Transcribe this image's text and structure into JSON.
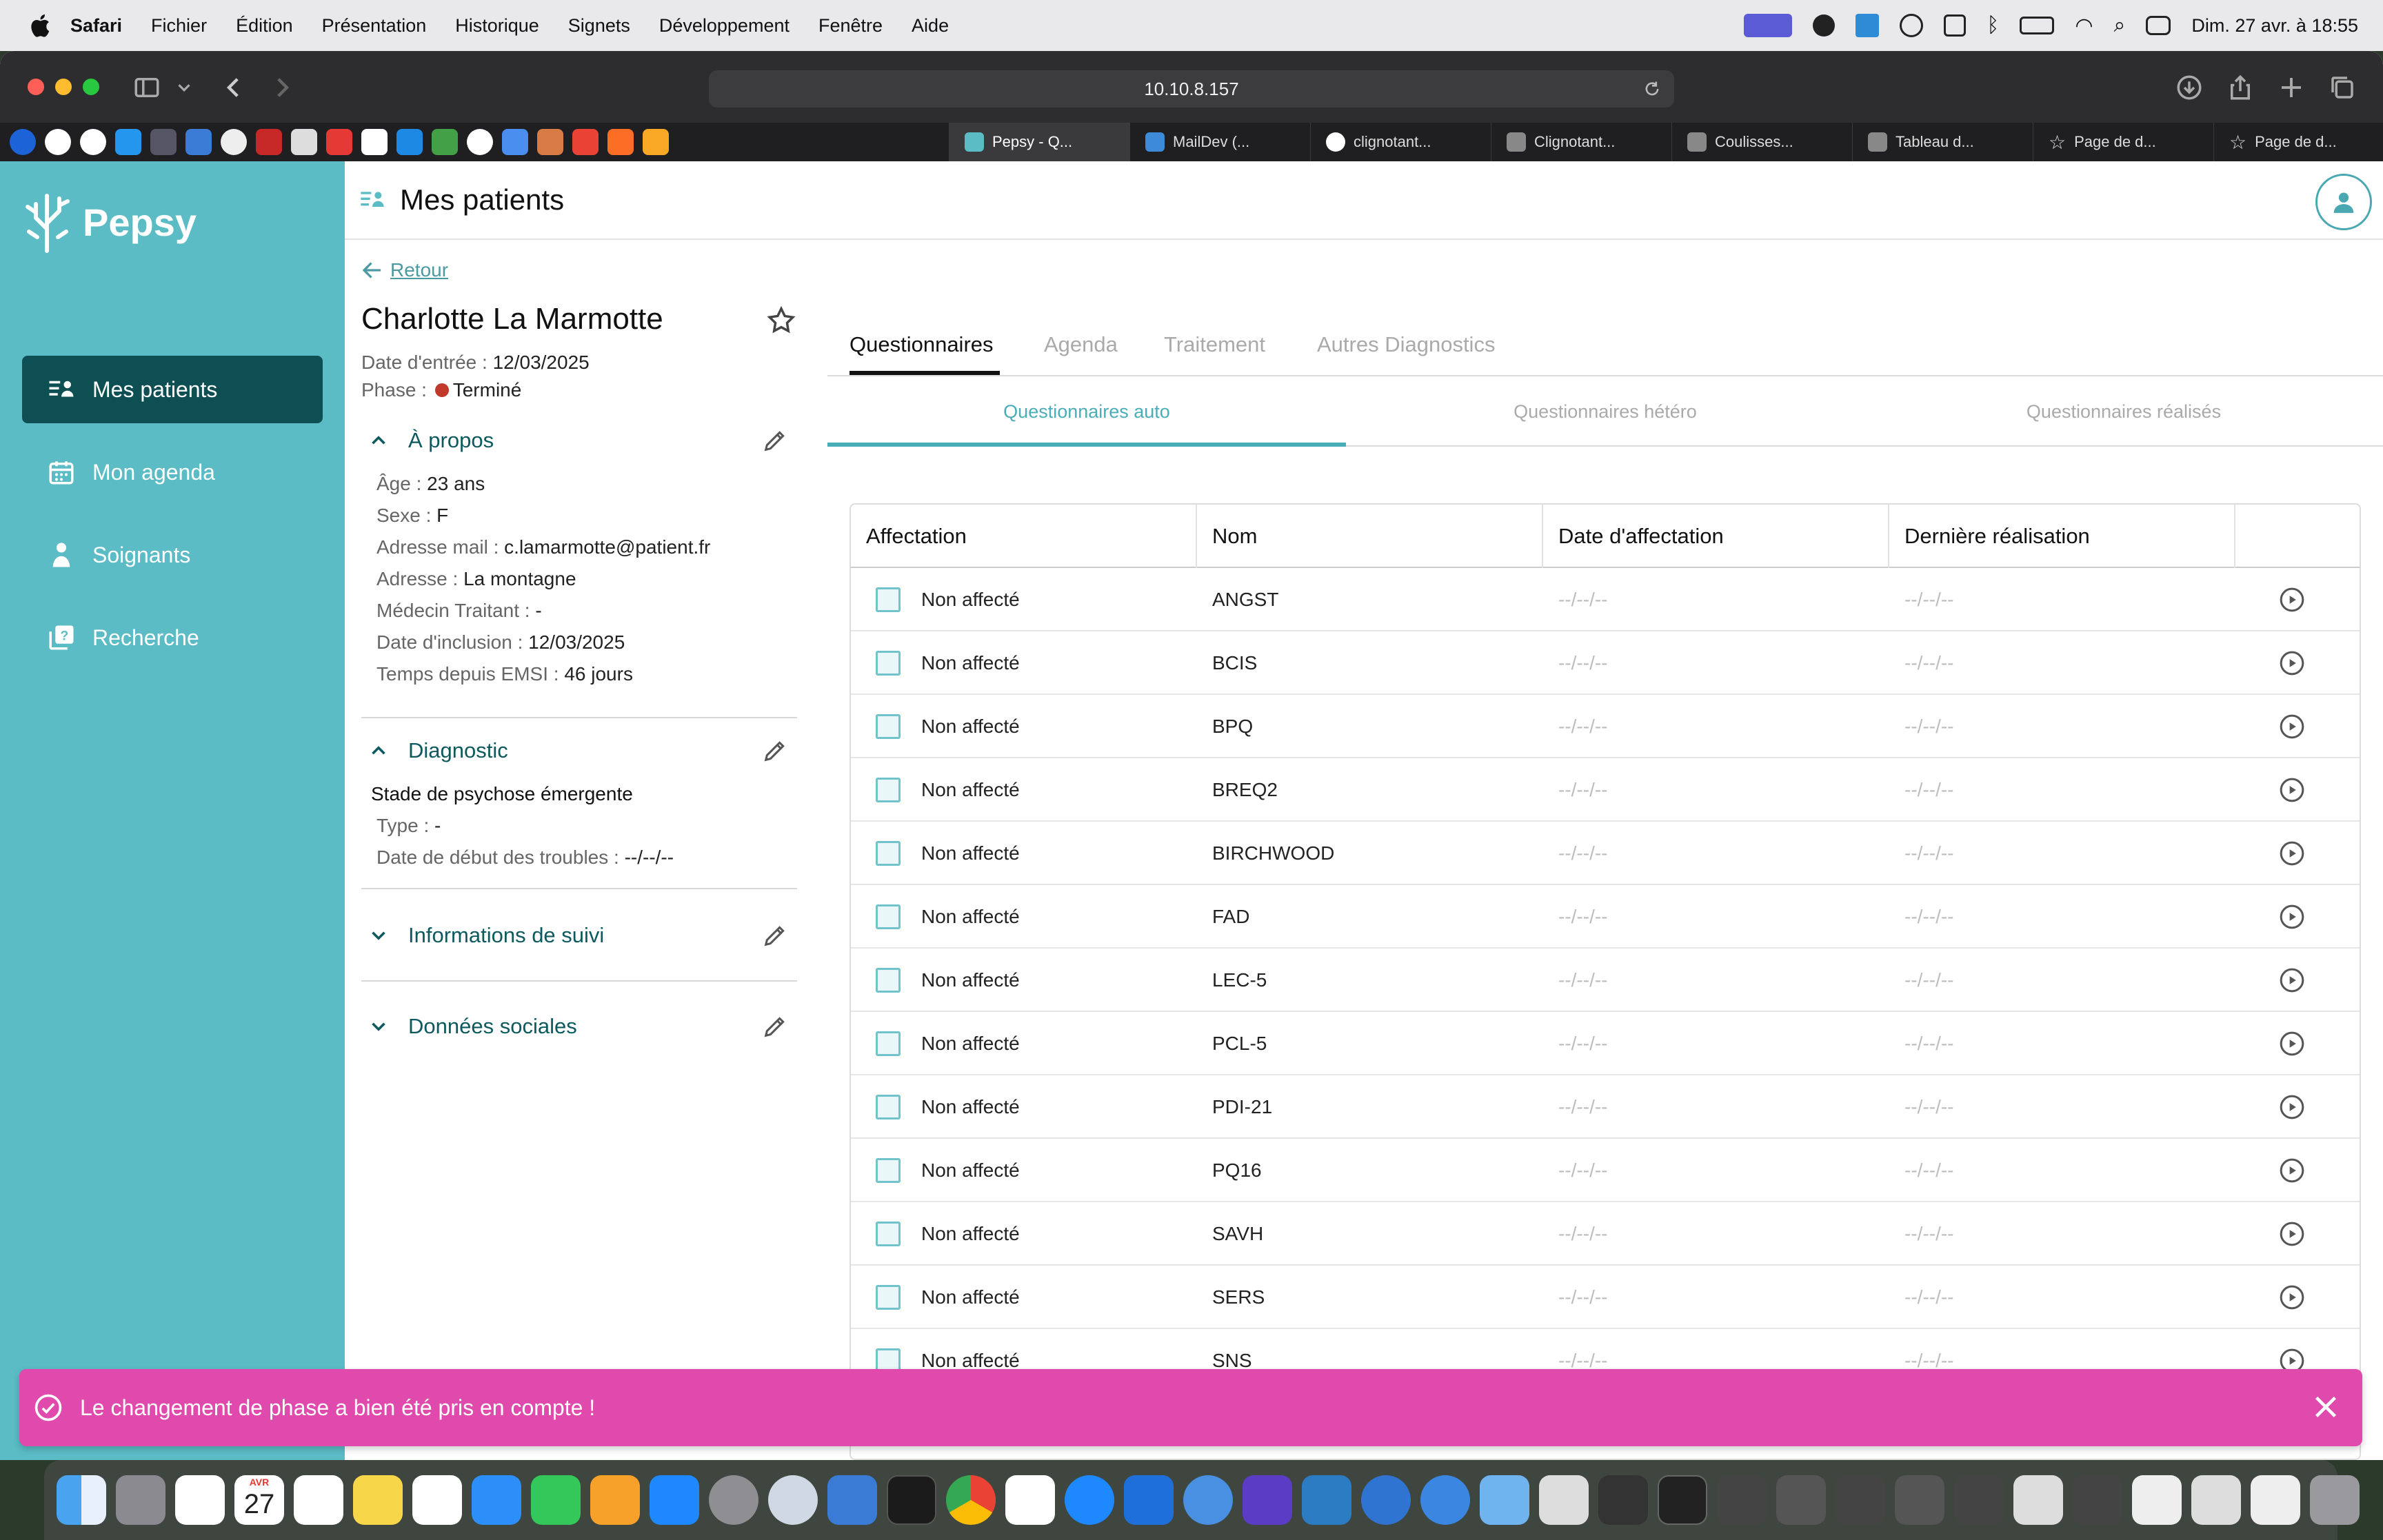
{
  "menubar": {
    "app": "Safari",
    "items": [
      "Fichier",
      "Édition",
      "Présentation",
      "Historique",
      "Signets",
      "Développement",
      "Fenêtre",
      "Aide"
    ],
    "datetime": "Dim. 27 avr. à 18:55"
  },
  "browser": {
    "url": "10.10.8.157",
    "tabs": [
      {
        "label": "Pepsy - Q...",
        "active": true
      },
      {
        "label": "MailDev (...",
        "active": false
      },
      {
        "label": "clignotant...",
        "active": false
      },
      {
        "label": "Clignotant...",
        "active": false
      },
      {
        "label": "Coulisses...",
        "active": false
      },
      {
        "label": "Tableau d...",
        "active": false
      },
      {
        "label": "Page de d...",
        "active": false
      },
      {
        "label": "Page de d...",
        "active": false
      }
    ]
  },
  "sidebar": {
    "logo": "Pepsy",
    "items": [
      {
        "label": "Mes patients",
        "active": true
      },
      {
        "label": "Mon agenda",
        "active": false
      },
      {
        "label": "Soignants",
        "active": false
      },
      {
        "label": "Recherche",
        "active": false
      }
    ]
  },
  "header": {
    "title": "Mes patients"
  },
  "patient": {
    "back_label": "Retour",
    "name": "Charlotte La Marmotte",
    "entry_key": "Date d'entrée : ",
    "entry_value": "12/03/2025",
    "phase_key": "Phase : ",
    "phase_value": "Terminé",
    "phase_color": "#c0392b"
  },
  "about": {
    "title": "À propos",
    "fields": [
      {
        "k": "Âge : ",
        "v": "23 ans"
      },
      {
        "k": "Sexe : ",
        "v": "F"
      },
      {
        "k": "Adresse mail : ",
        "v": "c.lamarmotte@patient.fr"
      },
      {
        "k": "Adresse : ",
        "v": "La montagne"
      },
      {
        "k": "Médecin Traitant : ",
        "v": "-"
      },
      {
        "k": "Date d'inclusion : ",
        "v": "12/03/2025"
      },
      {
        "k": "Temps depuis EMSI : ",
        "v": "46 jours"
      }
    ]
  },
  "diagnostic": {
    "title": "Diagnostic",
    "stage": "Stade de psychose émergente",
    "type_k": "Type : ",
    "type_v": "-",
    "date_k": "Date de début des troubles : ",
    "date_v": "--/--/--"
  },
  "suivi": {
    "title": "Informations de suivi"
  },
  "social": {
    "title": "Données sociales"
  },
  "tabs": [
    "Questionnaires",
    "Agenda",
    "Traitement",
    "Autres Diagnostics"
  ],
  "subtabs": [
    "Questionnaires auto",
    "Questionnaires hétéro",
    "Questionnaires réalisés"
  ],
  "table": {
    "headers": [
      "Affectation",
      "Nom",
      "Date d'affectation",
      "Dernière réalisation"
    ],
    "rows": [
      {
        "aff": "Non affecté",
        "nom": "ANGST",
        "date": "--/--/--",
        "last": "--/--/--"
      },
      {
        "aff": "Non affecté",
        "nom": "BCIS",
        "date": "--/--/--",
        "last": "--/--/--"
      },
      {
        "aff": "Non affecté",
        "nom": "BPQ",
        "date": "--/--/--",
        "last": "--/--/--"
      },
      {
        "aff": "Non affecté",
        "nom": "BREQ2",
        "date": "--/--/--",
        "last": "--/--/--"
      },
      {
        "aff": "Non affecté",
        "nom": "BIRCHWOOD",
        "date": "--/--/--",
        "last": "--/--/--"
      },
      {
        "aff": "Non affecté",
        "nom": "FAD",
        "date": "--/--/--",
        "last": "--/--/--"
      },
      {
        "aff": "Non affecté",
        "nom": "LEC-5",
        "date": "--/--/--",
        "last": "--/--/--"
      },
      {
        "aff": "Non affecté",
        "nom": "PCL-5",
        "date": "--/--/--",
        "last": "--/--/--"
      },
      {
        "aff": "Non affecté",
        "nom": "PDI-21",
        "date": "--/--/--",
        "last": "--/--/--"
      },
      {
        "aff": "Non affecté",
        "nom": "PQ16",
        "date": "--/--/--",
        "last": "--/--/--"
      },
      {
        "aff": "Non affecté",
        "nom": "SAVH",
        "date": "--/--/--",
        "last": "--/--/--"
      },
      {
        "aff": "Non affecté",
        "nom": "SERS",
        "date": "--/--/--",
        "last": "--/--/--"
      },
      {
        "aff": "Non affecté",
        "nom": "SNS",
        "date": "--/--/--",
        "last": "--/--/--"
      }
    ]
  },
  "toast": {
    "message": "Le changement de phase a bien été pris en compte !"
  },
  "dock": {
    "calendar_month": "AVR",
    "calendar_day": "27"
  },
  "colors": {
    "sidebar": "#5bbcc6",
    "nav_active": "#0d4f52",
    "accent": "#4aaeb8",
    "toast": "#e04aad"
  }
}
